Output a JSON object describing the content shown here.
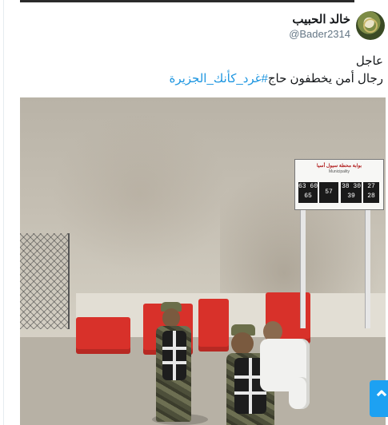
{
  "tweet": {
    "display_name": "خالد الحبيب",
    "handle": "@Bader2314",
    "line1": "عاجل",
    "line2_text": "رجال أمن يخطفون حاج",
    "line2_hashtag": "#غرد_كأنك_الجزيرة",
    "avatar_icon": "profile-avatar"
  },
  "photo": {
    "sign": {
      "title": "بوابة محطة سيول أسيا",
      "subtitle": "Municipality",
      "box1_top": "63 60",
      "box1_bottom": "65",
      "box2": "57",
      "box3_top": "38 30",
      "box3_bottom": "39",
      "box4_top": "27",
      "box4_bottom": "28"
    }
  },
  "ui": {
    "scroll_top_icon": "arrow-up-icon",
    "scroll_top_glyph": "⌃",
    "accent_color": "#1da1f2",
    "hashtag_color": "#1b95e0"
  }
}
